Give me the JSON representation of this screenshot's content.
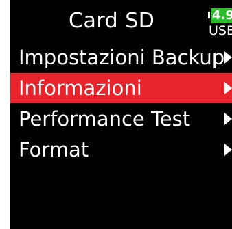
{
  "colors": {
    "screen_background": "#000000",
    "text": "#ffffff",
    "selection": "#e8232c",
    "battery": "#2dbe2d"
  },
  "header": {
    "title": "Card SD"
  },
  "status": {
    "battery_level": "4.9",
    "power_source": "USB"
  },
  "menu": {
    "selected_index": 1,
    "items": [
      {
        "label": "Impostazioni Backup",
        "arrow_icon": "chevron-right-icon"
      },
      {
        "label": "Informazioni",
        "arrow_icon": "chevron-right-icon"
      },
      {
        "label": "Performance Test",
        "arrow_icon": "chevron-right-icon"
      },
      {
        "label": "Format",
        "arrow_icon": "chevron-right-icon"
      }
    ]
  }
}
